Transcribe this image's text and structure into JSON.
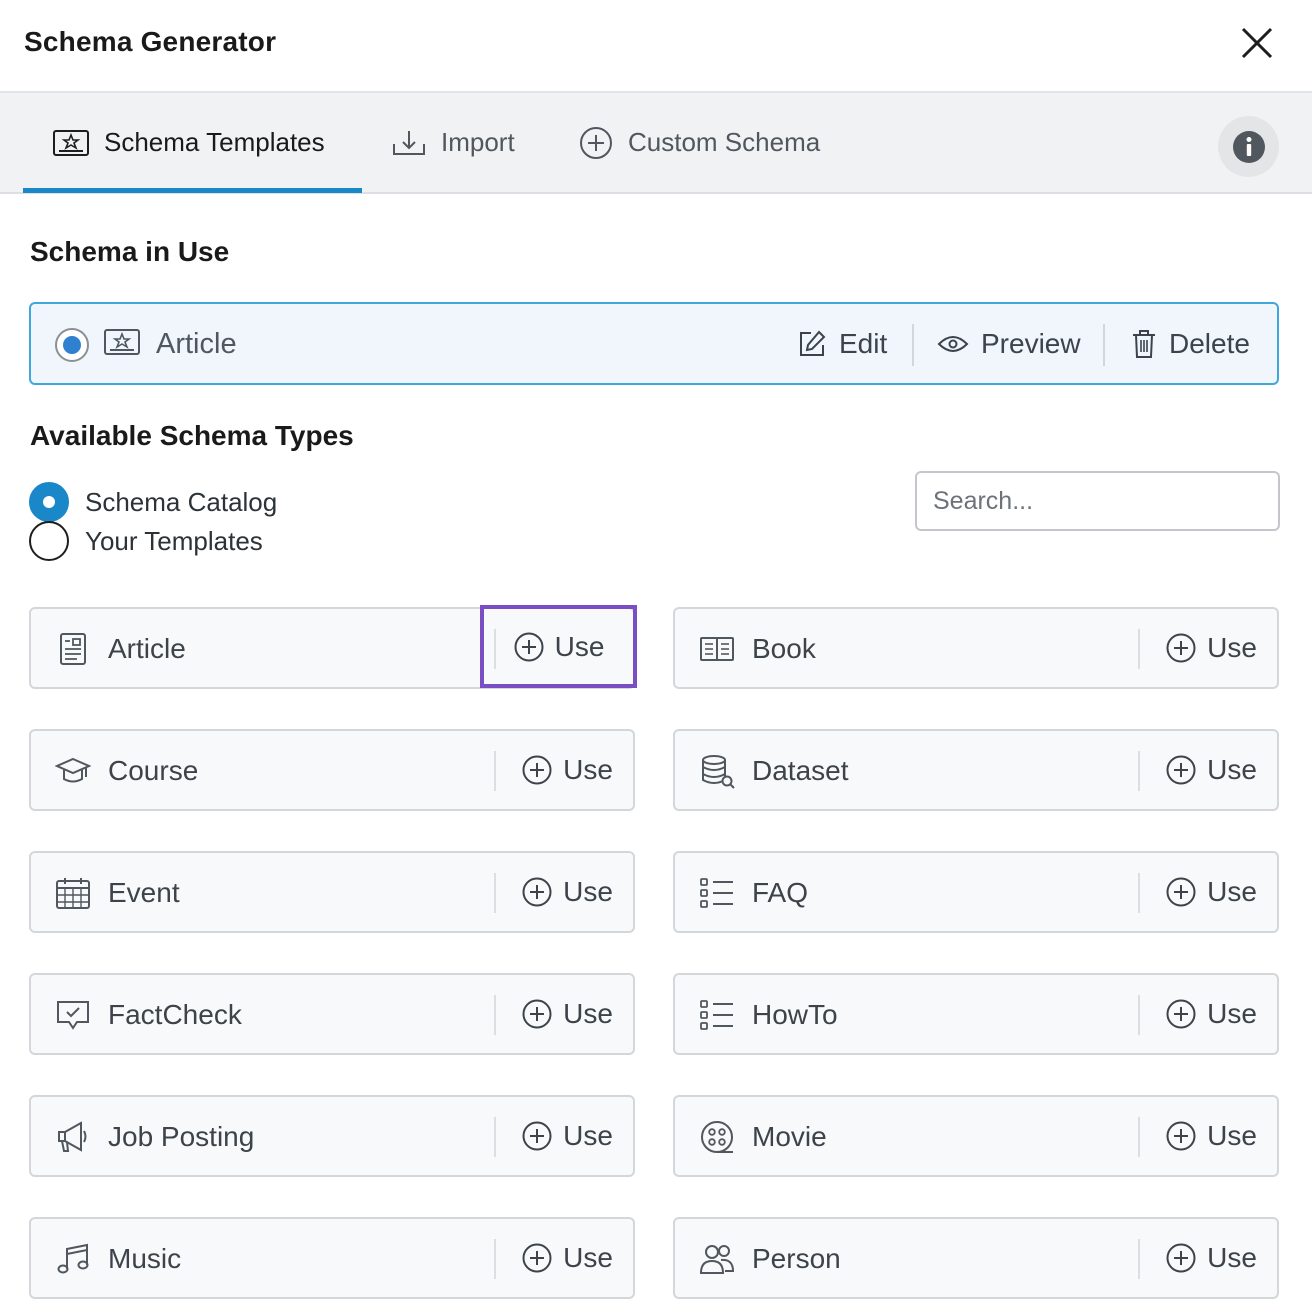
{
  "header": {
    "title": "Schema Generator"
  },
  "tabs": [
    {
      "label": "Schema Templates",
      "icon": "certificate-icon",
      "active": true
    },
    {
      "label": "Import",
      "icon": "import-icon",
      "active": false
    },
    {
      "label": "Custom Schema",
      "icon": "plus-circle-icon",
      "active": false
    }
  ],
  "in_use": {
    "heading": "Schema in Use",
    "name": "Article",
    "edit": "Edit",
    "preview": "Preview",
    "delete": "Delete"
  },
  "available": {
    "heading": "Available Schema Types",
    "options": [
      "Schema Catalog",
      "Your Templates"
    ],
    "selected": "Schema Catalog",
    "search_placeholder": "Search..."
  },
  "use_label": "Use",
  "schemas": [
    {
      "name": "Article",
      "icon": "article-icon"
    },
    {
      "name": "Book",
      "icon": "book-icon"
    },
    {
      "name": "Course",
      "icon": "graduation-cap-icon"
    },
    {
      "name": "Dataset",
      "icon": "database-icon"
    },
    {
      "name": "Event",
      "icon": "calendar-icon"
    },
    {
      "name": "FAQ",
      "icon": "list-icon"
    },
    {
      "name": "FactCheck",
      "icon": "checked-comment-icon"
    },
    {
      "name": "HowTo",
      "icon": "list-icon"
    },
    {
      "name": "Job Posting",
      "icon": "megaphone-icon"
    },
    {
      "name": "Movie",
      "icon": "film-reel-icon"
    },
    {
      "name": "Music",
      "icon": "music-note-icon"
    },
    {
      "name": "Person",
      "icon": "users-icon"
    }
  ],
  "colors": {
    "accent": "#1a87c9",
    "highlight": "#7b4fc4",
    "selected_bg": "#f0f6fc"
  }
}
